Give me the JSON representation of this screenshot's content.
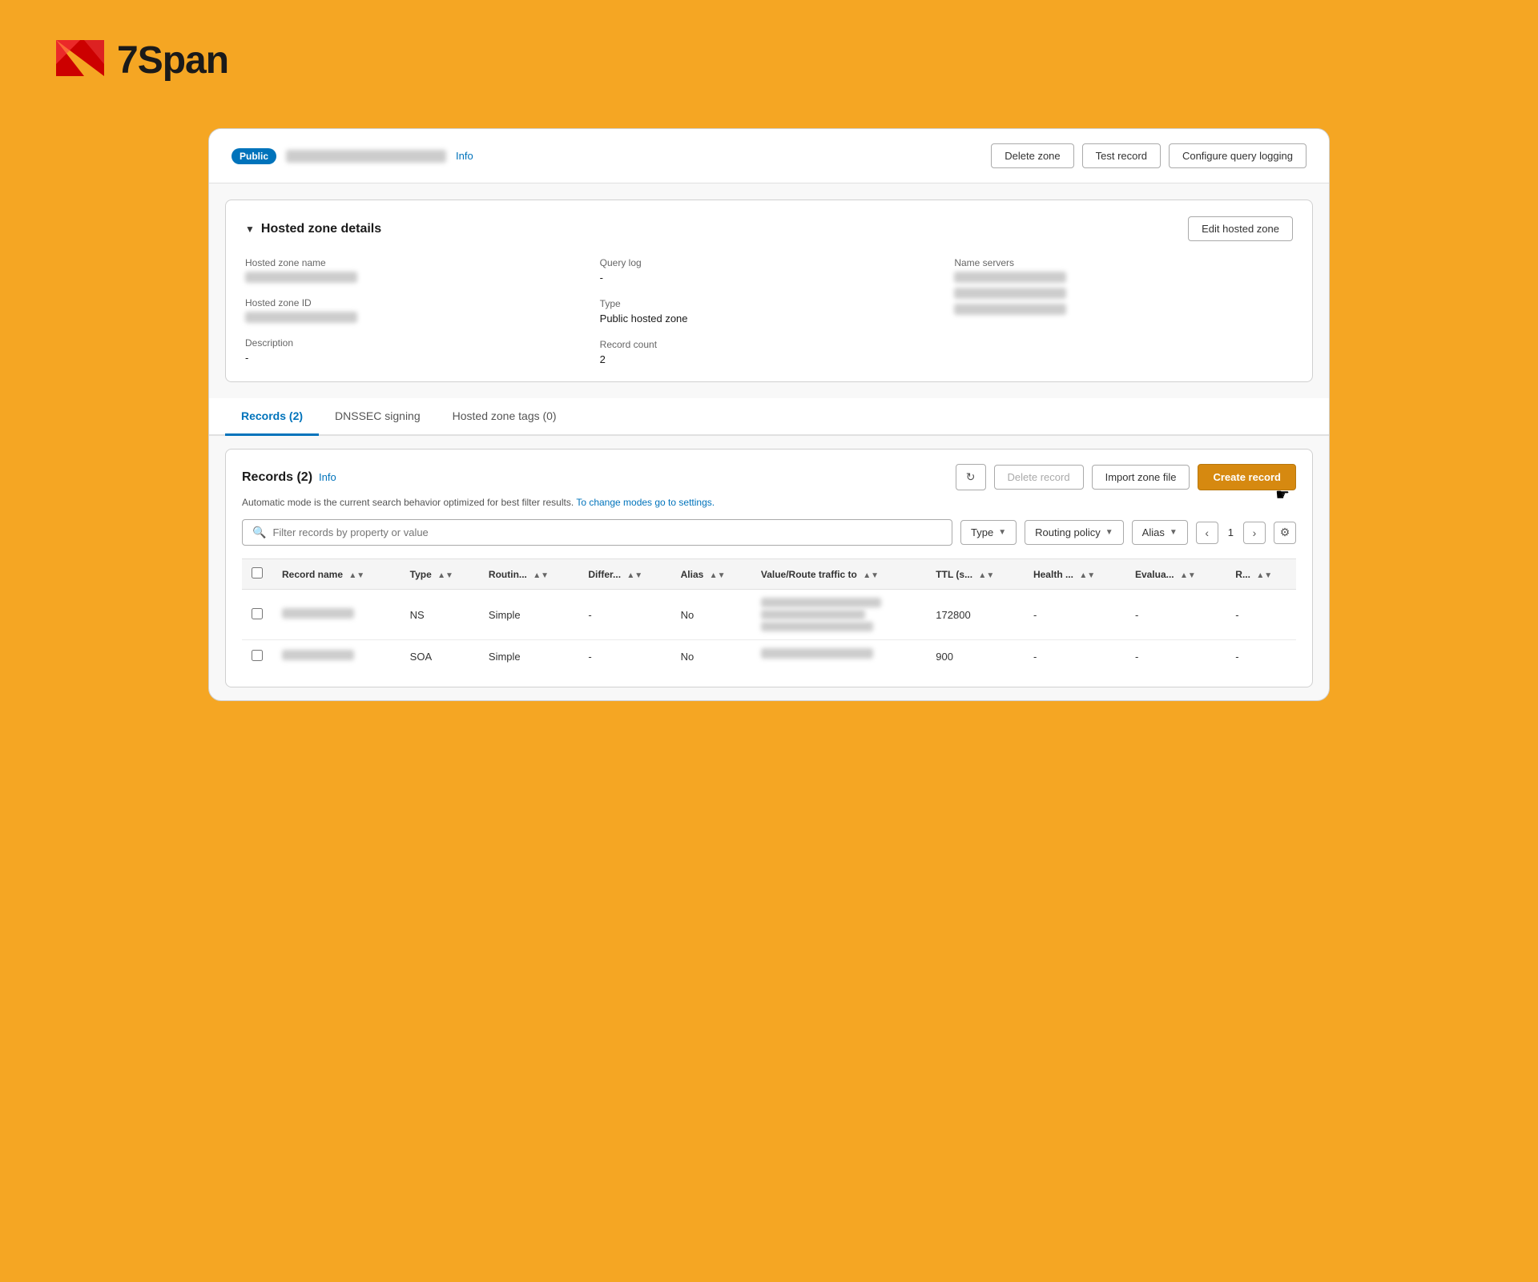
{
  "logo": {
    "text": "7Span"
  },
  "zone_header": {
    "badge": "Public",
    "info_label": "Info",
    "delete_zone_label": "Delete zone",
    "test_record_label": "Test record",
    "configure_label": "Configure query logging"
  },
  "hosted_zone_details": {
    "title": "Hosted zone details",
    "edit_button": "Edit hosted zone",
    "hosted_zone_name_label": "Hosted zone name",
    "hosted_zone_id_label": "Hosted zone ID",
    "description_label": "Description",
    "description_value": "-",
    "query_log_label": "Query log",
    "query_log_value": "-",
    "type_label": "Type",
    "type_value": "Public hosted zone",
    "record_count_label": "Record count",
    "record_count_value": "2",
    "name_servers_label": "Name servers"
  },
  "tabs": [
    {
      "label": "Records (2)",
      "id": "records",
      "active": true
    },
    {
      "label": "DNSSEC signing",
      "id": "dnssec",
      "active": false
    },
    {
      "label": "Hosted zone tags (0)",
      "id": "tags",
      "active": false
    }
  ],
  "records_section": {
    "title": "Records (2)",
    "info_link": "Info",
    "refresh_icon": "↻",
    "delete_record_label": "Delete record",
    "import_label": "Import zone file",
    "create_label": "Create record",
    "auto_mode_text": "Automatic mode is the current search behavior optimized for best filter results.",
    "change_modes_link": "To change modes go to settings.",
    "filter_placeholder": "Filter records by property or value",
    "type_filter": "Type",
    "routing_filter": "Routing policy",
    "alias_filter": "Alias",
    "page_number": "1",
    "table": {
      "columns": [
        {
          "label": "Record name",
          "id": "record_name"
        },
        {
          "label": "Type",
          "id": "type"
        },
        {
          "label": "Routin...",
          "id": "routing"
        },
        {
          "label": "Differ...",
          "id": "differ"
        },
        {
          "label": "Alias",
          "id": "alias"
        },
        {
          "label": "Value/Route traffic to",
          "id": "value"
        },
        {
          "label": "TTL (s...",
          "id": "ttl"
        },
        {
          "label": "Health ...",
          "id": "health"
        },
        {
          "label": "Evalua...",
          "id": "evaluate"
        },
        {
          "label": "R...",
          "id": "r"
        }
      ],
      "rows": [
        {
          "type": "NS",
          "routing": "Simple",
          "differ": "-",
          "alias": "No",
          "ttl": "172800",
          "health": "-",
          "evaluate": "-",
          "r": "-"
        },
        {
          "type": "SOA",
          "routing": "Simple",
          "differ": "-",
          "alias": "No",
          "ttl": "900",
          "health": "-",
          "evaluate": "-",
          "r": "-"
        }
      ]
    }
  }
}
